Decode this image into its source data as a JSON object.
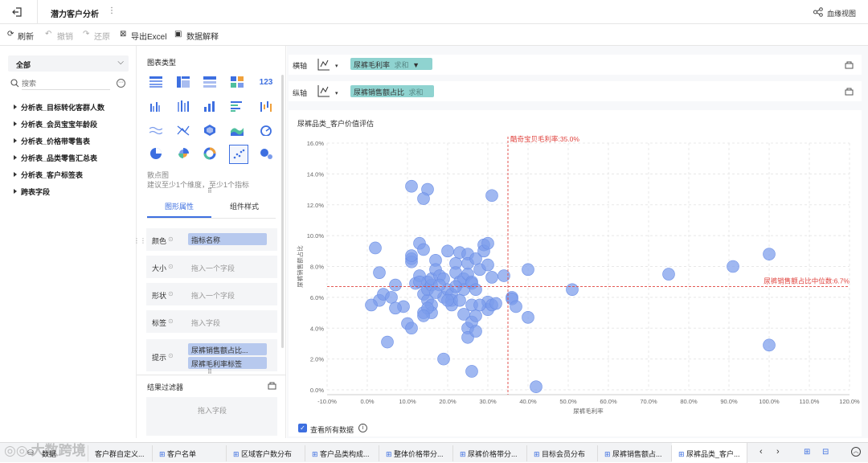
{
  "header": {
    "title": "潜力客户分析",
    "lineage": "血缘视图"
  },
  "toolbar": {
    "refresh": "刷新",
    "undo": "撤销",
    "redo": "还原",
    "export": "导出Excel",
    "explain": "数据解释"
  },
  "left": {
    "dropdown": "全部",
    "search_placeholder": "搜索",
    "items": [
      "分析表_目标转化客群人数",
      "分析表_会员宝宝年龄段",
      "分析表_价格带零售表",
      "分析表_品类零售汇总表",
      "分析表_客户标签表",
      "跨表字段"
    ]
  },
  "mid": {
    "chart_type_title": "图表类型",
    "selected_name": "散点图",
    "selected_hint": "建议至少1个维度，至少1个指标",
    "tabs": [
      "图形属性",
      "组件样式"
    ],
    "props": {
      "color": "颜色",
      "color_value": "指标名称",
      "size": "大小",
      "size_ph": "拖入一个字段",
      "shape": "形状",
      "shape_ph": "拖入一个字段",
      "label": "标签",
      "label_ph": "拖入字段",
      "tooltip": "提示",
      "tooltip_values": [
        "尿裤销售额占比...",
        "尿裤毛利率标签"
      ]
    },
    "filter_title": "结果过滤器",
    "filter_ph": "拖入字段"
  },
  "axes": {
    "x_label": "横轴",
    "x_field": "尿裤毛利率",
    "x_agg": "求和",
    "y_label": "纵轴",
    "y_field": "尿裤销售额占比",
    "y_agg": "求和"
  },
  "show_all": "查看所有数据",
  "tabs": [
    "数据",
    "客户群自定义...",
    "客户名单",
    "区域客户数分布",
    "客户品类构成...",
    "整体价格带分...",
    "尿裤价格带分...",
    "目标会员分布",
    "尿裤销售额占...",
    "尿裤品类_客户..."
  ],
  "watermark": "大数跨境",
  "colors": {
    "accent": "#3d6fe0",
    "bubble": "#7b9cec",
    "refline": "#e0443f",
    "chip_teal": "#8fd3d0",
    "chip_blue": "#b7c9ee"
  },
  "chart_data": {
    "type": "scatter",
    "title": "尿裤品类_客户价值评估",
    "xlabel": "尿裤毛利率",
    "ylabel": "尿裤销售额占比",
    "xlim": [
      -0.1,
      1.2
    ],
    "ylim": [
      0,
      0.16
    ],
    "xticks": [
      "-10.0%",
      "0.0%",
      "10.0%",
      "20.0%",
      "30.0%",
      "40.0%",
      "50.0%",
      "60.0%",
      "70.0%",
      "80.0%",
      "90.0%",
      "100.0%",
      "110.0%",
      "120.0%"
    ],
    "yticks": [
      "0.0%",
      "2.0%",
      "4.0%",
      "6.0%",
      "8.0%",
      "10.0%",
      "12.0%",
      "14.0%",
      "16.0%"
    ],
    "refline_x": {
      "value": 0.35,
      "label": "酷奇宝贝毛利率:35.0%"
    },
    "refline_y": {
      "value": 0.067,
      "label": "尿裤销售额占比中位数:6.7%"
    },
    "grid": true,
    "points": [
      [
        0.11,
        0.132
      ],
      [
        0.15,
        0.13
      ],
      [
        0.14,
        0.124
      ],
      [
        0.31,
        0.126
      ],
      [
        0.02,
        0.092
      ],
      [
        0.03,
        0.076
      ],
      [
        0.03,
        0.058
      ],
      [
        0.01,
        0.055
      ],
      [
        0.04,
        0.062
      ],
      [
        0.06,
        0.06
      ],
      [
        0.07,
        0.068
      ],
      [
        0.09,
        0.054
      ],
      [
        0.1,
        0.043
      ],
      [
        0.11,
        0.04
      ],
      [
        0.05,
        0.031
      ],
      [
        0.07,
        0.053
      ],
      [
        0.13,
        0.095
      ],
      [
        0.11,
        0.085
      ],
      [
        0.11,
        0.083
      ],
      [
        0.11,
        0.087
      ],
      [
        0.12,
        0.069
      ],
      [
        0.13,
        0.074
      ],
      [
        0.14,
        0.091
      ],
      [
        0.14,
        0.062
      ],
      [
        0.15,
        0.058
      ],
      [
        0.15,
        0.065
      ],
      [
        0.15,
        0.07
      ],
      [
        0.16,
        0.068
      ],
      [
        0.16,
        0.055
      ],
      [
        0.17,
        0.084
      ],
      [
        0.16,
        0.05
      ],
      [
        0.14,
        0.05
      ],
      [
        0.13,
        0.07
      ],
      [
        0.15,
        0.053
      ],
      [
        0.14,
        0.048
      ],
      [
        0.16,
        0.072
      ],
      [
        0.17,
        0.078
      ],
      [
        0.18,
        0.074
      ],
      [
        0.19,
        0.072
      ],
      [
        0.19,
        0.06
      ],
      [
        0.2,
        0.09
      ],
      [
        0.2,
        0.065
      ],
      [
        0.21,
        0.062
      ],
      [
        0.21,
        0.058
      ],
      [
        0.21,
        0.055
      ],
      [
        0.22,
        0.082
      ],
      [
        0.22,
        0.076
      ],
      [
        0.23,
        0.089
      ],
      [
        0.23,
        0.07
      ],
      [
        0.24,
        0.072
      ],
      [
        0.24,
        0.049
      ],
      [
        0.24,
        0.065
      ],
      [
        0.25,
        0.088
      ],
      [
        0.25,
        0.082
      ],
      [
        0.25,
        0.075
      ],
      [
        0.26,
        0.07
      ],
      [
        0.26,
        0.069
      ],
      [
        0.25,
        0.04
      ],
      [
        0.25,
        0.034
      ],
      [
        0.26,
        0.044
      ],
      [
        0.26,
        0.055
      ],
      [
        0.27,
        0.048
      ],
      [
        0.27,
        0.038
      ],
      [
        0.27,
        0.085
      ],
      [
        0.27,
        0.065
      ],
      [
        0.28,
        0.078
      ],
      [
        0.29,
        0.094
      ],
      [
        0.29,
        0.09
      ],
      [
        0.3,
        0.081
      ],
      [
        0.3,
        0.095
      ],
      [
        0.3,
        0.057
      ],
      [
        0.3,
        0.052
      ],
      [
        0.31,
        0.073
      ],
      [
        0.31,
        0.055
      ],
      [
        0.32,
        0.056
      ],
      [
        0.34,
        0.074
      ],
      [
        0.26,
        0.012
      ],
      [
        0.19,
        0.02
      ],
      [
        0.36,
        0.06
      ],
      [
        0.36,
        0.059
      ],
      [
        0.37,
        0.054
      ],
      [
        0.4,
        0.047
      ],
      [
        0.4,
        0.078
      ],
      [
        0.42,
        0.002
      ],
      [
        0.51,
        0.065
      ],
      [
        0.75,
        0.075
      ],
      [
        0.91,
        0.08
      ],
      [
        1.0,
        0.088
      ],
      [
        1.0,
        0.029
      ],
      [
        0.23,
        0.058
      ],
      [
        0.28,
        0.055
      ],
      [
        0.2,
        0.058
      ],
      [
        0.18,
        0.068
      ],
      [
        0.17,
        0.063
      ],
      [
        0.22,
        0.067
      ]
    ]
  }
}
